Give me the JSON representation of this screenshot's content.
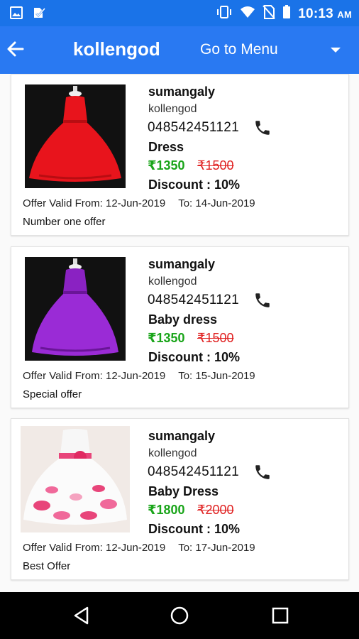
{
  "status_bar": {
    "time": "10:13",
    "ampm": "AM",
    "left_icons": [
      "image-icon",
      "check-doc-icon"
    ],
    "right_icons": [
      "vibrate-icon",
      "wifi-icon",
      "no-sim-icon",
      "battery-icon"
    ]
  },
  "app_bar": {
    "back_icon": "arrow-left-icon",
    "title": "kollengod",
    "menu_label": "Go to Menu",
    "dropdown_icon": "caret-down-icon"
  },
  "offers": [
    {
      "shop": "sumangaly",
      "place": "kollengod",
      "phone": "048542451121",
      "product": "Dress",
      "price": "₹1350",
      "old_price": "₹1500",
      "discount": "Discount : 10%",
      "valid_from_label": "Offer Valid From: 12-Jun-2019",
      "valid_to_label": "To:  14-Jun-2019",
      "note": "Number one offer",
      "dress_color": "#e8141c"
    },
    {
      "shop": "sumangaly",
      "place": "kollengod",
      "phone": "048542451121",
      "product": "Baby dress",
      "price": "₹1350",
      "old_price": "₹1500",
      "discount": "Discount : 10%",
      "valid_from_label": "Offer Valid From: 12-Jun-2019",
      "valid_to_label": "To:  15-Jun-2019",
      "note": "Special offer",
      "dress_color": "#8a22c2"
    },
    {
      "shop": "sumangaly",
      "place": "kollengod",
      "phone": "048542451121",
      "product": "Baby Dress",
      "price": "₹1800",
      "old_price": "₹2000",
      "discount": "Discount : 10%",
      "valid_from_label": "Offer Valid From: 12-Jun-2019",
      "valid_to_label": "To:  17-Jun-2019",
      "note": "Best Offer",
      "dress_color": "#f4f1ee"
    }
  ],
  "nav_bar": {
    "icons": [
      "back-triangle-icon",
      "home-circle-icon",
      "recents-square-icon"
    ]
  },
  "colors": {
    "app_bar": "#2979f2",
    "status_bar": "#1a73e8",
    "price": "#1aa51a",
    "old_price": "#e02020"
  }
}
